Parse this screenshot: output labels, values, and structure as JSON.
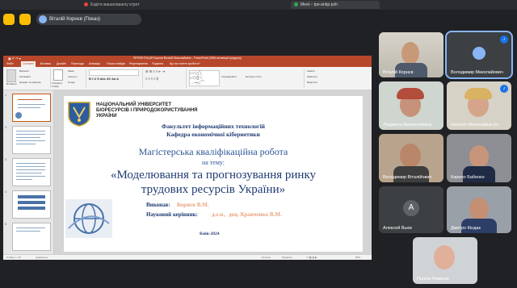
{
  "browser": {
    "tab1": "Ездіти жашалишелу єтрет",
    "tab2": "Meet – tpe-ankp-pzh"
  },
  "meet": {
    "speaker_label": "Віталій Корнєв (Показ)",
    "participants": [
      {
        "name": "Віталій Корнєв"
      },
      {
        "name": "Володимир Миколайович"
      },
      {
        "name": "Людмила Валентинівна"
      },
      {
        "name": "Наталія Миколаївна Кл"
      },
      {
        "name": "Володимир Віталійович"
      },
      {
        "name": "Кирило Бабенко"
      },
      {
        "name": "Алексей Вьюк",
        "initial": "А"
      },
      {
        "name": "Дмитро Кіндак"
      },
      {
        "name": "Поліна Ремінна"
      }
    ]
  },
  "powerpoint": {
    "title": "ПРЕЗЕНТАЦІЯ Корнєв Віталій Миколайович - PowerPoint (Збій активації продукту)",
    "tabs": [
      "Файл",
      "Основне",
      "Вставка",
      "Дизайн",
      "Переходи",
      "Анімація",
      "Показ слайдів",
      "Рецензування",
      "Подання"
    ],
    "search": "Що ви хочете зробити?",
    "ribbon": {
      "paste": "Вставити",
      "cut": "Вирізати",
      "copy": "Копіювати",
      "format": "Формат за зразком",
      "new_slide": "Створити слайд",
      "layout": "Макет",
      "reset": "Скинути",
      "section": "Розділ",
      "find": "Знайти",
      "replace": "Замінити",
      "select": "Виділити",
      "arrange": "Упорядкувати",
      "quick_styles": "Експрес-стилі"
    },
    "status": {
      "slide": "Слайд 1 з 15",
      "lang": "українська",
      "notes": "Нотатки",
      "comments": "Примітки",
      "zoom": "59%"
    }
  },
  "slide": {
    "university_1": "НАЦІОНАЛЬНИЙ УНІВЕРСИТЕТ",
    "university_2": "БІОРЕСУРСІВ І ПРИРОДОКОРИСТУВАННЯ",
    "university_3": "УКРАЇНИ",
    "faculty": "Факультет інформаційних технологій",
    "department": "Кафедра економічної кібернетики",
    "work_type": "Магістерська кваліфікаційна робота",
    "on_topic": "на тему:",
    "title_1": "«Моделювання та прогнозування ринку",
    "title_2": "трудових ресурсів України»",
    "performer_label": "Виконав:",
    "performer": "Корнєв В.М.",
    "supervisor_label": "Науковий керівник:",
    "supervisor_degree": "д.е.н.,",
    "supervisor_rest": "доц. Кравченко В.М.",
    "city_year": "Київ-2024"
  },
  "colors": {
    "ppt_accent": "#b7472a",
    "meet_bg": "#202124",
    "slide_blue": "#1f3b73",
    "highlight_orange": "#e8a37c"
  }
}
